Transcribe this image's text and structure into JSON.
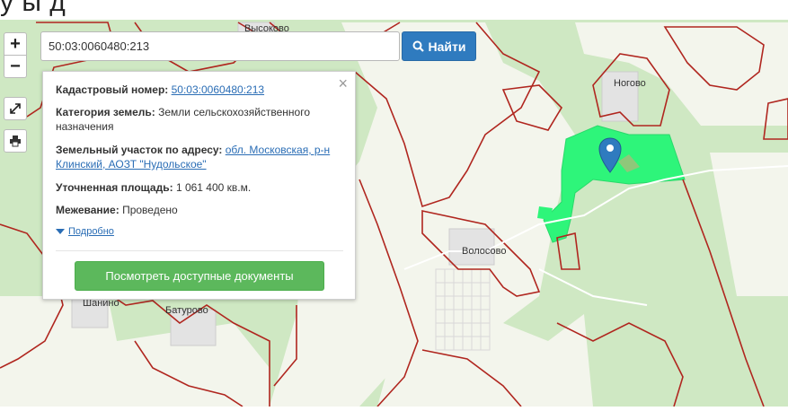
{
  "header": {
    "text": "у           ы   д             "
  },
  "map": {
    "labels": {
      "vysokovo": "Высоково",
      "nogovo": "Ногово",
      "volosovo": "Волосово",
      "shanino": "Шанино",
      "baturovo": "Батурово"
    },
    "colors": {
      "forest": "#cfe8c3",
      "field": "#f4f6ee",
      "boundary": "#b0261f",
      "selected": "#2ef57a",
      "marker": "#2f7bbf"
    }
  },
  "controls": {
    "zoom_in": "+",
    "zoom_out": "−",
    "fullscreen_icon": "expand-icon",
    "print_icon": "printer-icon"
  },
  "search": {
    "value": "50:03:0060480:213",
    "button_label": "Найти",
    "button_icon": "search-icon"
  },
  "popup": {
    "cadastral_label": "Кадастровый номер:",
    "cadastral_value": "50:03:0060480:213",
    "category_label": "Категория земель:",
    "category_value": "Земли сельскохозяйственного назначения",
    "address_label": "Земельный участок по адресу:",
    "address_value": "обл. Московская, р-н Клинский, АОЗТ \"Нудольское\"",
    "area_label": "Уточненная площадь:",
    "area_value": "1 061 400 кв.м.",
    "survey_label": "Межевание:",
    "survey_value": "Проведено",
    "more_label": "Подробно",
    "docs_button": "Посмотреть доступные документы",
    "close": "×"
  }
}
